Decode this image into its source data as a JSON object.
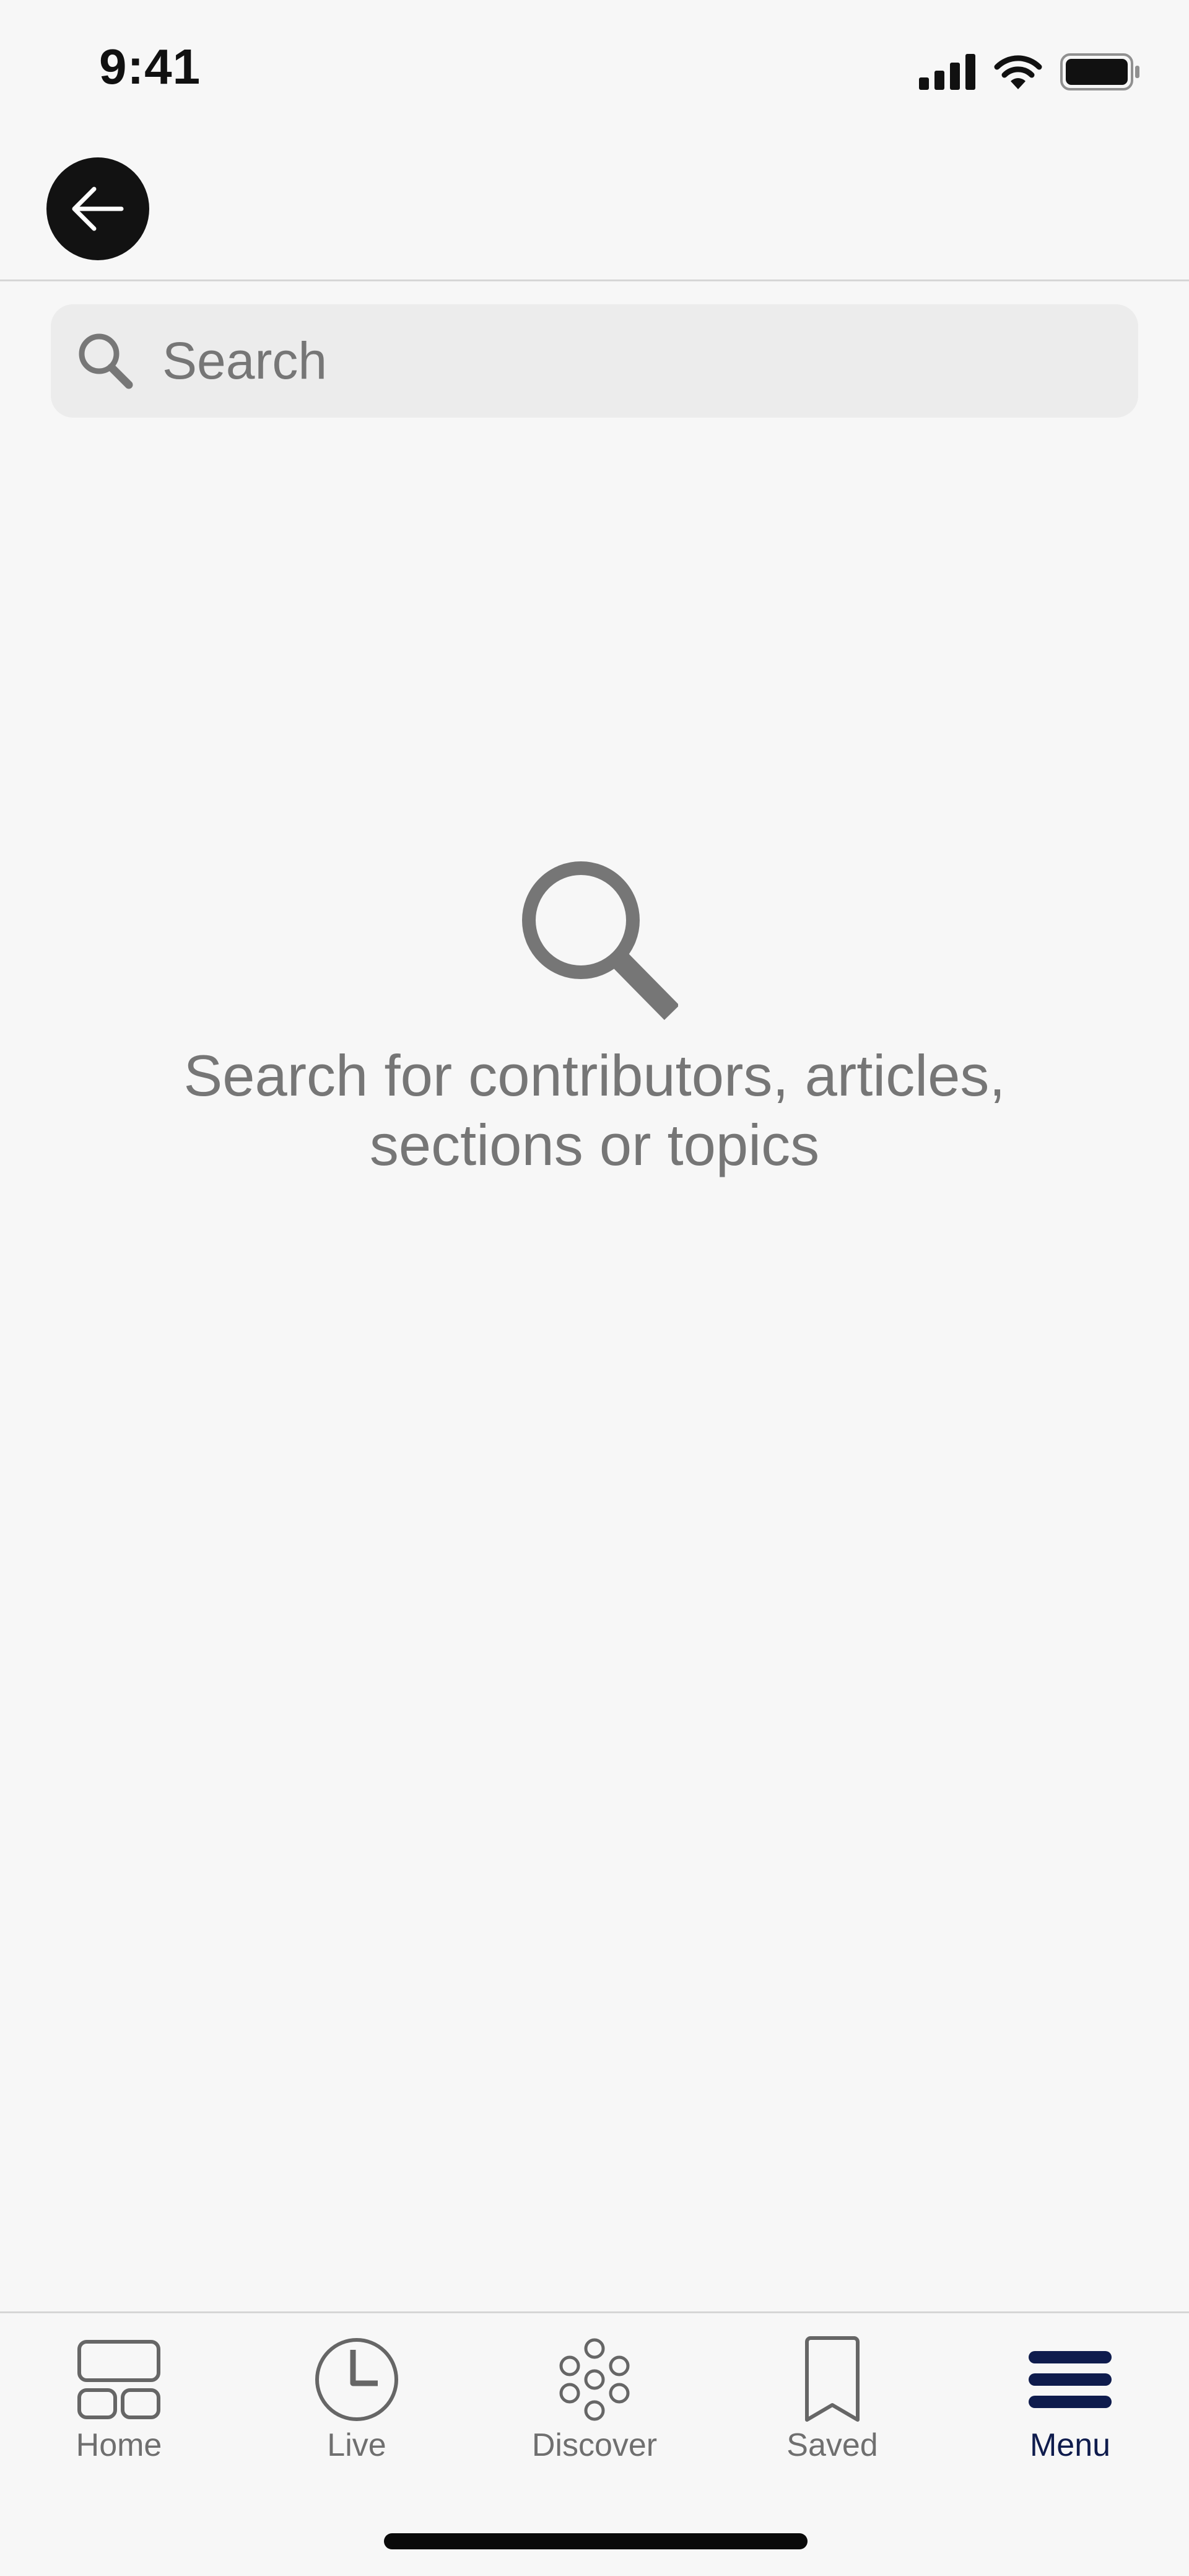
{
  "status_bar": {
    "time": "9:41",
    "icons": [
      "cellular-signal-icon",
      "wifi-icon",
      "battery-icon"
    ]
  },
  "header": {
    "back_icon": "arrow-left-icon"
  },
  "search": {
    "placeholder": "Search",
    "value": "",
    "icon": "search-icon"
  },
  "empty_state": {
    "icon": "magnifier-icon",
    "line1": "Search for contributors, articles,",
    "line2": "sections or topics"
  },
  "tab_bar": {
    "tabs": [
      {
        "label": "Home",
        "icon": "home-grid-icon",
        "active": false
      },
      {
        "label": "Live",
        "icon": "clock-icon",
        "active": false
      },
      {
        "label": "Discover",
        "icon": "discover-dots-icon",
        "active": false
      },
      {
        "label": "Saved",
        "icon": "bookmark-icon",
        "active": false
      },
      {
        "label": "Menu",
        "icon": "menu-bars-icon",
        "active": true
      }
    ]
  },
  "colors": {
    "background": "#f7f7f7",
    "accent_active": "#0f1c4d",
    "muted_text": "#767676",
    "back_button": "#121212"
  }
}
